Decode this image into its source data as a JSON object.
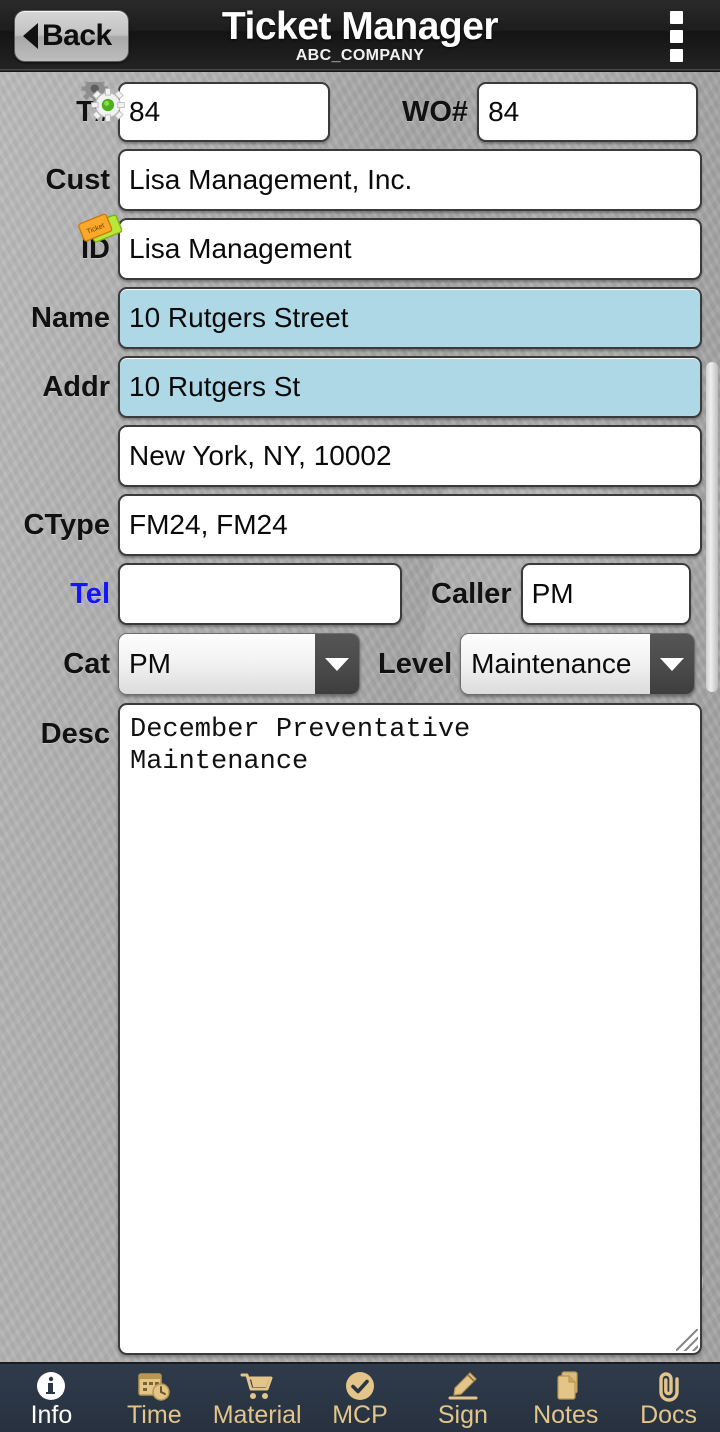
{
  "titlebar": {
    "back_label": "Back",
    "title": "Ticket Manager",
    "subtitle": "ABC_COMPANY",
    "overflow_icon": "overflow-menu-icon"
  },
  "form": {
    "ticket_number": {
      "label": "T#",
      "value": "84",
      "icon": "gears-icon"
    },
    "work_order": {
      "label": "WO#",
      "value": "84"
    },
    "customer": {
      "label": "Cust",
      "value": "Lisa Management, Inc."
    },
    "id": {
      "label": "ID",
      "value": "Lisa Management",
      "icon": "tickets-icon"
    },
    "name": {
      "label": "Name",
      "value": "10 Rutgers Street",
      "highlighted": true
    },
    "address": {
      "label": "Addr",
      "value": "10 Rutgers St",
      "highlighted": true
    },
    "city_state_zip": {
      "label": "",
      "value": "New York, NY, 10002"
    },
    "ctype": {
      "label": "CType",
      "value": "FM24, FM24"
    },
    "tel": {
      "label": "Tel",
      "value": "",
      "placeholder": "",
      "label_color": "#1414ff"
    },
    "caller": {
      "label": "Caller",
      "value": "PM"
    },
    "category": {
      "label": "Cat",
      "value": "PM",
      "options": [
        "PM"
      ]
    },
    "level": {
      "label": "Level",
      "value": "Maintenance",
      "options": [
        "Maintenance"
      ]
    },
    "description": {
      "label": "Desc",
      "value": "December Preventative\nMaintenance"
    },
    "gauge_icon": "gauge-icon"
  },
  "colors": {
    "highlight_field": "#aed8e6",
    "tab_bar": "#2b3645",
    "tab_label": "#e3c489",
    "tab_active_label": "#ffffff",
    "tel_label": "#1414ff"
  },
  "tabbar": {
    "items": [
      {
        "label": "Info",
        "icon": "info-icon",
        "active": true
      },
      {
        "label": "Time",
        "icon": "calendar-clock-icon",
        "active": false
      },
      {
        "label": "Material",
        "icon": "shopping-cart-icon",
        "active": false
      },
      {
        "label": "MCP",
        "icon": "check-circle-icon",
        "active": false
      },
      {
        "label": "Sign",
        "icon": "pen-signature-icon",
        "active": false
      },
      {
        "label": "Notes",
        "icon": "documents-icon",
        "active": false
      },
      {
        "label": "Docs",
        "icon": "paperclip-icon",
        "active": false
      }
    ]
  }
}
